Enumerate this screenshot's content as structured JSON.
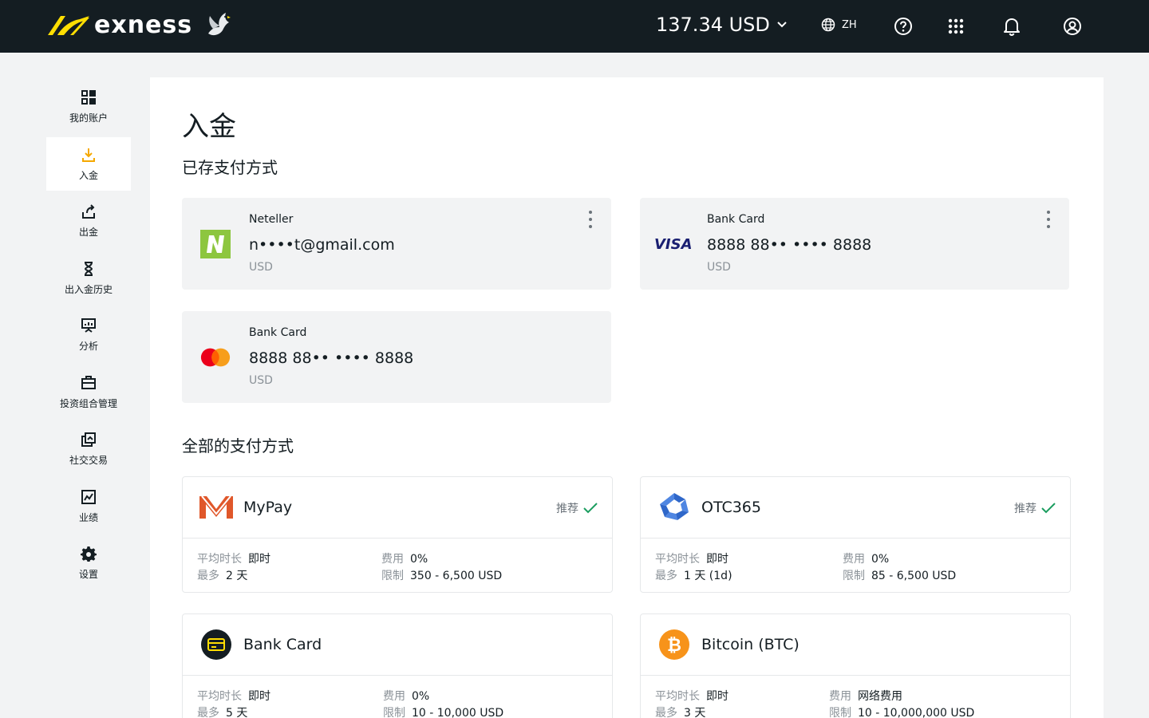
{
  "header": {
    "brand": "exness",
    "balance": "137.34 USD",
    "language": "ZH"
  },
  "sidebar": {
    "items": [
      {
        "label": "我的账户",
        "icon": "grid-icon"
      },
      {
        "label": "入金",
        "icon": "download-icon",
        "active": true
      },
      {
        "label": "出金",
        "icon": "withdraw-icon"
      },
      {
        "label": "出入金历史",
        "icon": "hourglass-icon"
      },
      {
        "label": "分析",
        "icon": "presentation-icon"
      },
      {
        "label": "投资组合管理",
        "icon": "briefcase-icon"
      },
      {
        "label": "社交交易",
        "icon": "copy-icon"
      },
      {
        "label": "业绩",
        "icon": "chart-icon"
      },
      {
        "label": "设置",
        "icon": "gear-icon"
      }
    ]
  },
  "main": {
    "title": "入金",
    "saved_title": "已存支付方式",
    "saved": [
      {
        "kind": "Neteller",
        "number": "n••••t@gmail.com",
        "currency": "USD",
        "logo": "neteller-logo"
      },
      {
        "kind": "Bank Card",
        "number": "8888 88•• •••• 8888",
        "currency": "USD",
        "logo": "visa-logo"
      },
      {
        "kind": "Bank Card",
        "number": "8888 88•• •••• 8888",
        "currency": "USD",
        "logo": "mastercard-logo"
      }
    ],
    "all_title": "全部的支付方式",
    "methods": [
      {
        "name": "MyPay",
        "recommended": "推荐",
        "logo": "mypay-logo",
        "time_label": "平均时长",
        "time": "即时",
        "max_label": "最多",
        "max": "2 天",
        "fee_label": "费用",
        "fee": "0%",
        "limit_label": "限制",
        "limit": "350 - 6,500 USD"
      },
      {
        "name": "OTC365",
        "recommended": "推荐",
        "logo": "otc365-logo",
        "time_label": "平均时长",
        "time": "即时",
        "max_label": "最多",
        "max": "1 天 (1d)",
        "fee_label": "费用",
        "fee": "0%",
        "limit_label": "限制",
        "limit": "85 - 6,500 USD"
      },
      {
        "name": "Bank Card",
        "recommended": "",
        "logo": "bank-card-icon",
        "time_label": "平均时长",
        "time": "即时",
        "max_label": "最多",
        "max": "5 天",
        "fee_label": "费用",
        "fee": "0%",
        "limit_label": "限制",
        "limit": "10 - 10,000 USD"
      },
      {
        "name": "Bitcoin (BTC)",
        "recommended": "",
        "logo": "bitcoin-icon",
        "time_label": "平均时长",
        "time": "即时",
        "max_label": "最多",
        "max": "3 天",
        "fee_label": "费用",
        "fee": "网络费用",
        "limit_label": "限制",
        "limit": "10 - 10,000,000 USD"
      }
    ]
  },
  "colors": {
    "topbar": "#141d22",
    "accent": "#ffde02",
    "panel": "#ffffff",
    "card": "#f2f3f4",
    "muted": "#8b9298",
    "check": "#1b9d5f"
  }
}
